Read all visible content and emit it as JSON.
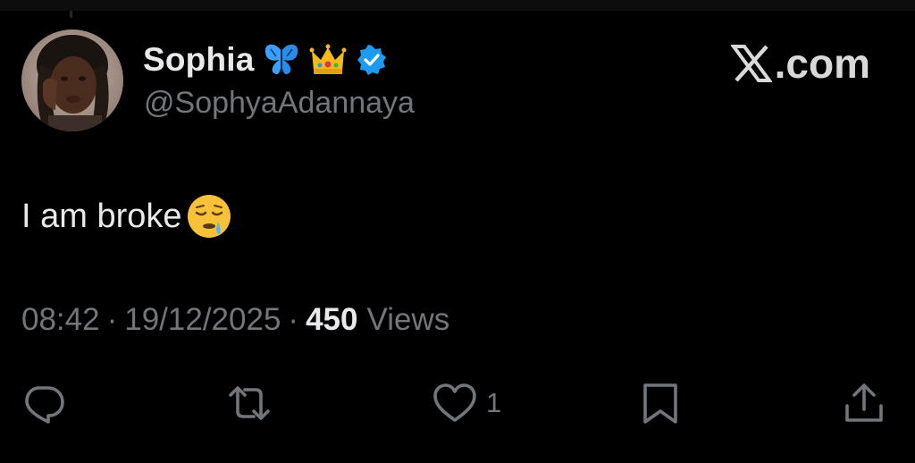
{
  "author": {
    "display_name": "Sophia",
    "name_emojis": [
      "butterfly-emoji",
      "crown-emoji"
    ],
    "verified": true,
    "handle": "@SophyaAdannaya"
  },
  "brand": {
    "label": ".com",
    "logo": "x-logo-icon"
  },
  "tweet": {
    "text": "I am broke",
    "emoji": "sleepy-face-emoji"
  },
  "meta": {
    "time": "08:42",
    "separator": "·",
    "date": "19/12/2025",
    "views_count": "450",
    "views_label": "Views"
  },
  "actions": {
    "reply": {
      "icon": "reply-icon"
    },
    "repost": {
      "icon": "repost-icon"
    },
    "like": {
      "icon": "heart-icon",
      "count": "1"
    },
    "bookmark": {
      "icon": "bookmark-icon"
    },
    "share": {
      "icon": "share-icon"
    }
  },
  "colors": {
    "background": "#000000",
    "primary_text": "#e7e9ea",
    "secondary_text": "#71767b",
    "verified_blue": "#1d9bf0"
  }
}
